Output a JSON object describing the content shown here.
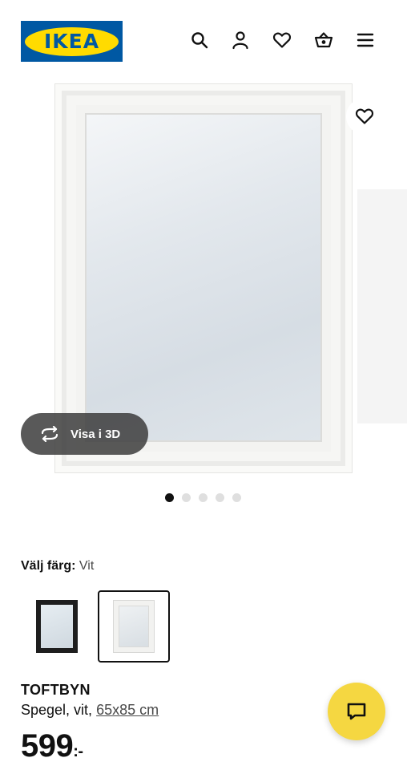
{
  "header": {
    "logo_text": "IKEA",
    "icons": [
      "search-icon",
      "user-icon",
      "heart-icon",
      "basket-icon",
      "menu-icon"
    ]
  },
  "gallery": {
    "favorite_icon": "heart-icon",
    "view_3d_label": "Visa i 3D",
    "view_3d_icon": "rotate-icon",
    "dot_count": 5,
    "active_dot": 0
  },
  "color": {
    "label": "Välj färg:",
    "value": "Vit",
    "options": [
      "black",
      "white"
    ],
    "selected": "white"
  },
  "product": {
    "name": "TOFTBYN",
    "description": "Spegel, vit,",
    "measure": "65x85 cm",
    "price": "599",
    "price_suffix": ":-"
  },
  "chat": {
    "icon": "chat-icon"
  },
  "colors": {
    "ikea_blue": "#0058a3",
    "ikea_yellow": "#ffdb00",
    "chat_yellow": "#f5d741",
    "pill_dark": "#3c3c3c"
  }
}
